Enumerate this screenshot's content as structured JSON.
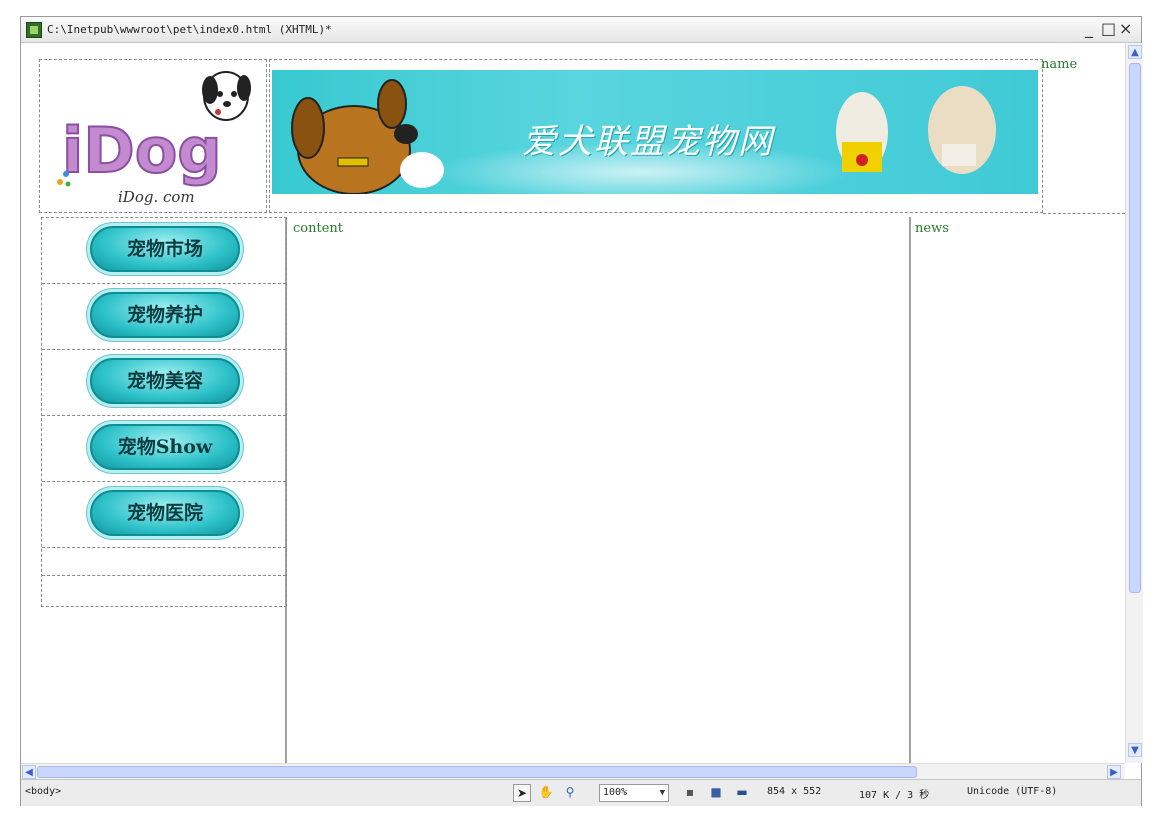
{
  "window": {
    "title": "C:\\Inetpub\\wwwroot\\pet\\index0.html (XHTML)*",
    "min_glyph": "_",
    "max_glyph": "□",
    "close_glyph": "×"
  },
  "header": {
    "logo_text": "iDog",
    "logo_caption": "iDog. com",
    "slogan": "爱犬联盟宠物网",
    "name_label": "name"
  },
  "nav": {
    "items": [
      {
        "label": "宠物市场"
      },
      {
        "label": "宠物养护"
      },
      {
        "label": "宠物美容"
      },
      {
        "label": "宠物Show"
      },
      {
        "label": "宠物医院"
      }
    ]
  },
  "main": {
    "content_label": "content",
    "news_label": "news"
  },
  "statusbar": {
    "tag_path": "<body>",
    "zoom": "100%",
    "dimensions": "854 x 552",
    "size_time": "107 K / 3 秒",
    "encoding": "Unicode (UTF-8)"
  },
  "colors": {
    "banner_bg": "#3fcad6",
    "nav_button": "#2ec2c9",
    "label_green": "#2a7a2a",
    "scroll_thumb": "#c9d6ff"
  }
}
